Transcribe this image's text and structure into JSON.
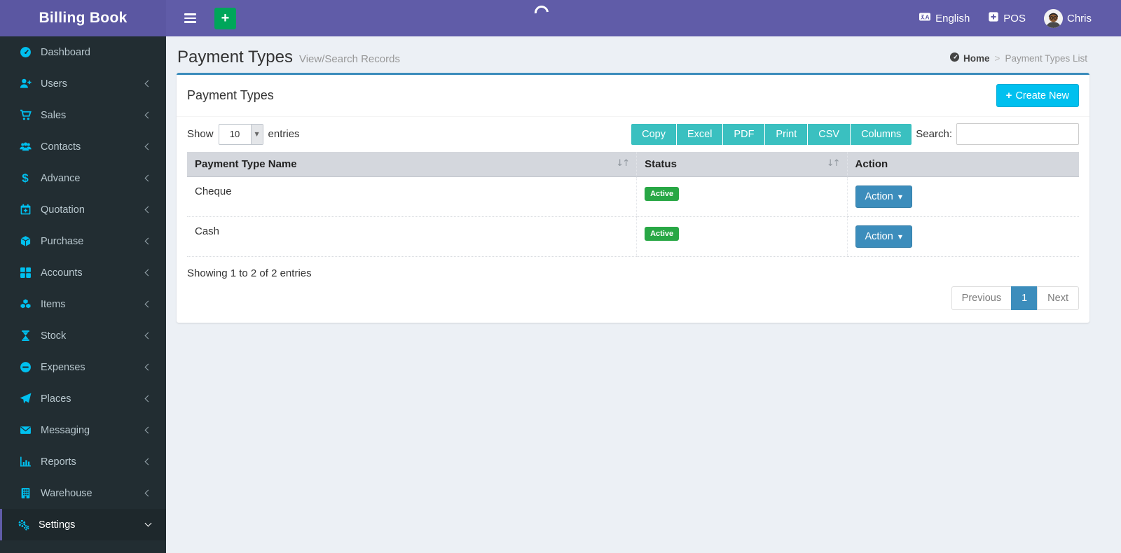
{
  "app": {
    "title": "Billing Book"
  },
  "navbar": {
    "language": "English",
    "pos": "POS",
    "user": "Chris"
  },
  "icons": {
    "plus": "+",
    "caret_down": "▼",
    "sort": "↓↑",
    "breadcrumb_sep": ">",
    "dollar": "$"
  },
  "sidebar": {
    "items": [
      {
        "label": "Dashboard",
        "icon": "dashboard-icon",
        "chevron": "none"
      },
      {
        "label": "Users",
        "icon": "user-plus-icon",
        "chevron": "left"
      },
      {
        "label": "Sales",
        "icon": "cart-icon",
        "chevron": "left"
      },
      {
        "label": "Contacts",
        "icon": "users-icon",
        "chevron": "left"
      },
      {
        "label": "Advance",
        "icon": "dollar-icon",
        "chevron": "left"
      },
      {
        "label": "Quotation",
        "icon": "calendar-plus-icon",
        "chevron": "left"
      },
      {
        "label": "Purchase",
        "icon": "cube-icon",
        "chevron": "left"
      },
      {
        "label": "Accounts",
        "icon": "grid-icon",
        "chevron": "left"
      },
      {
        "label": "Items",
        "icon": "cubes-icon",
        "chevron": "left"
      },
      {
        "label": "Stock",
        "icon": "hourglass-icon",
        "chevron": "left"
      },
      {
        "label": "Expenses",
        "icon": "minus-circle-icon",
        "chevron": "left"
      },
      {
        "label": "Places",
        "icon": "paper-plane-icon",
        "chevron": "left"
      },
      {
        "label": "Messaging",
        "icon": "envelope-icon",
        "chevron": "left"
      },
      {
        "label": "Reports",
        "icon": "bar-chart-icon",
        "chevron": "left"
      },
      {
        "label": "Warehouse",
        "icon": "building-icon",
        "chevron": "left"
      },
      {
        "label": "Settings",
        "icon": "gears-icon",
        "chevron": "down",
        "active": true
      }
    ]
  },
  "page": {
    "title": "Payment Types",
    "subtitle": "View/Search Records"
  },
  "breadcrumb": {
    "home": "Home",
    "current": "Payment Types List"
  },
  "panel": {
    "title": "Payment Types",
    "create_button": "Create New"
  },
  "controls": {
    "show_label": "Show",
    "page_length": "10",
    "entries_label": "entries",
    "export_buttons": [
      "Copy",
      "Excel",
      "PDF",
      "Print",
      "CSV",
      "Columns"
    ],
    "search_label": "Search:",
    "search_value": ""
  },
  "table": {
    "headers": [
      {
        "label": "Payment Type Name",
        "sortable": true
      },
      {
        "label": "Status",
        "sortable": true
      },
      {
        "label": "Action",
        "sortable": false
      }
    ],
    "rows": [
      {
        "name": "Cheque",
        "status": "Active",
        "action": "Action"
      },
      {
        "name": "Cash",
        "status": "Active",
        "action": "Action"
      }
    ]
  },
  "footer": {
    "info": "Showing 1 to 2 of 2 entries",
    "previous": "Previous",
    "page": "1",
    "next": "Next"
  },
  "colors": {
    "navbar": "#605ca8",
    "sidebar": "#222d32",
    "icon_accent": "#00c0ef",
    "add_button": "#00a65a",
    "create_button": "#00c0ef",
    "export_button": "#3ac0c0",
    "badge_active": "#28a745",
    "action_button": "#3c8dbc",
    "panel_top_border": "#3c8dbc",
    "pagination_active": "#3c8dbc",
    "content_bg": "#ecf0f5"
  }
}
